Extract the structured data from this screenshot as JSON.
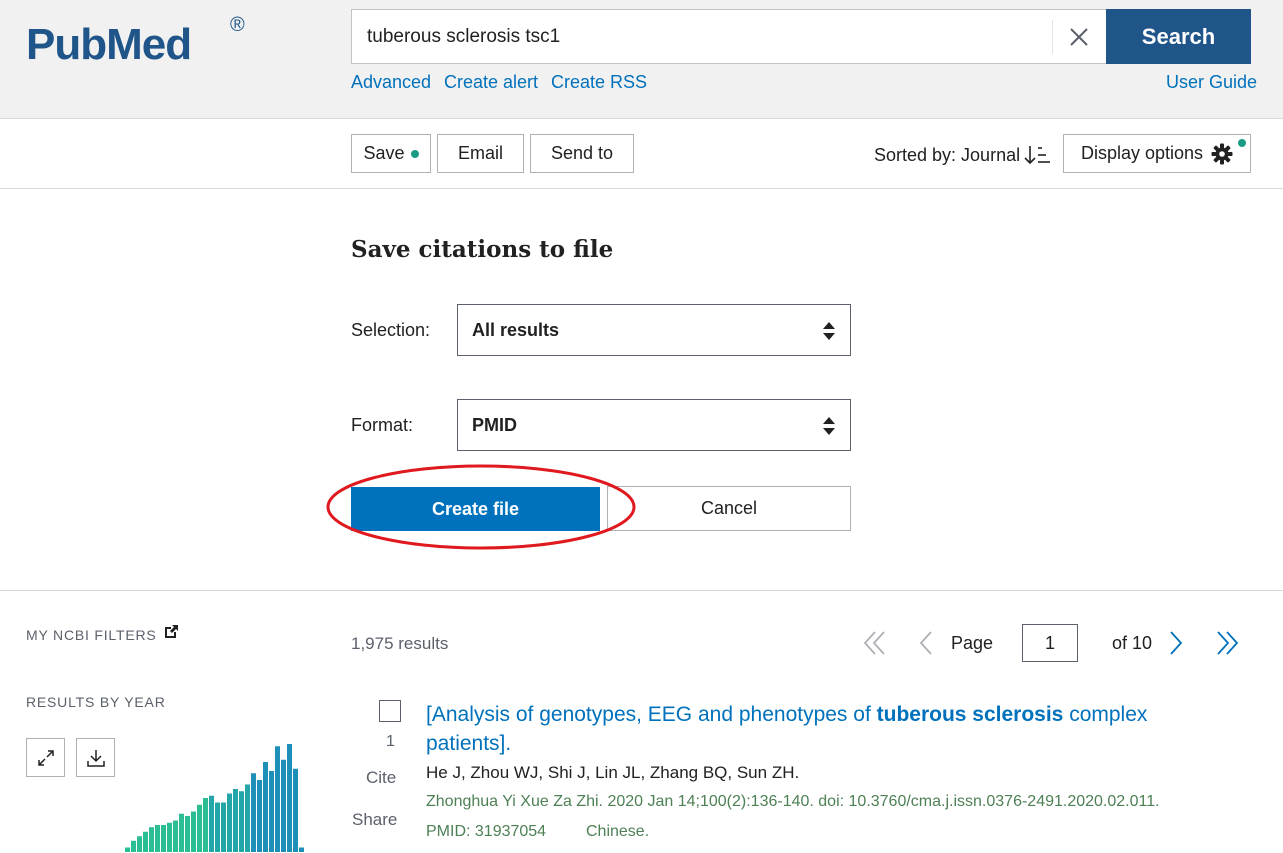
{
  "header": {
    "logo_text": "PubMed",
    "logo_reg": "®",
    "search_value": "tuberous sclerosis tsc1",
    "search_button": "Search",
    "links": {
      "advanced": "Advanced",
      "create_alert": "Create alert",
      "create_rss": "Create RSS",
      "user_guide": "User Guide"
    }
  },
  "actionbar": {
    "save": "Save",
    "email": "Email",
    "send_to": "Send to",
    "sorted_by": "Sorted by: Journal",
    "display_options": "Display options"
  },
  "save_panel": {
    "title": "Save citations to file",
    "selection_label": "Selection:",
    "selection_value": "All results",
    "format_label": "Format:",
    "format_value": "PMID",
    "create_button": "Create file",
    "cancel_button": "Cancel"
  },
  "sidebar": {
    "filters_heading": "MY NCBI FILTERS",
    "results_by_year": "RESULTS BY YEAR",
    "year_counts": [
      2,
      5,
      7,
      9,
      11,
      12,
      12,
      13,
      14,
      17,
      16,
      18,
      21,
      24,
      25,
      22,
      22,
      26,
      28,
      27,
      30,
      35,
      32,
      40,
      36,
      47,
      41,
      48,
      37,
      2
    ]
  },
  "results": {
    "count": "1,975 results",
    "page_label": "Page",
    "page_value": "1",
    "of_pages": "of 10",
    "items": [
      {
        "number": "1",
        "cite": "Cite",
        "share": "Share",
        "title_before": "[Analysis of genotypes, EEG and phenotypes of ",
        "title_bold": "tuberous sclerosis",
        "title_after": " complex patients].",
        "authors": "He J, Zhou WJ, Shi J, Lin JL, Zhang BQ, Sun ZH.",
        "journal": "Zhonghua Yi Xue Za Zhi. 2020 Jan 14;100(2):136-140. doi: 10.3760/cma.j.issn.0376-2491.2020.02.011.",
        "pmid": "PMID: 31937054",
        "language": "Chinese."
      }
    ]
  },
  "colors": {
    "brand": "#20558a",
    "link": "#0071bc",
    "accent_dot": "#1a9b84",
    "highlight_ellipse": "#e0191f"
  }
}
